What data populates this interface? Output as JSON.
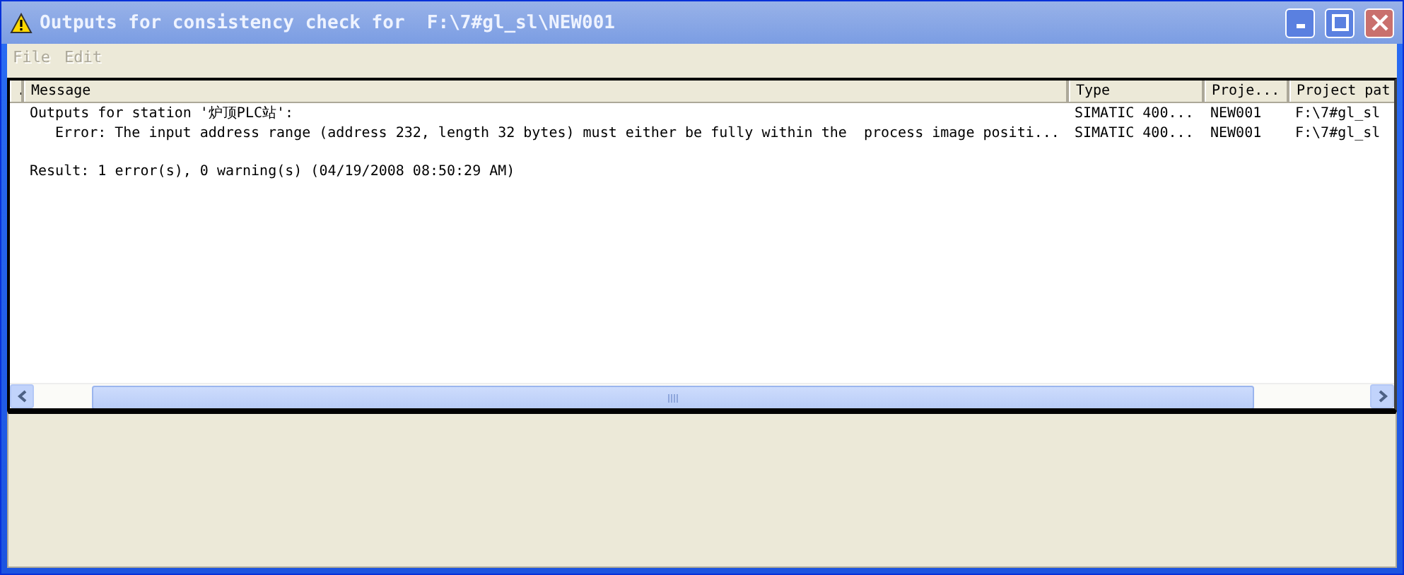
{
  "window": {
    "title": "Outputs for consistency check for  F:\\7#gl_sl\\NEW001"
  },
  "menu": [
    {
      "label": "File",
      "disabled": true
    },
    {
      "label": "Edit",
      "disabled": true
    }
  ],
  "table": {
    "columns": [
      {
        "label": "."
      },
      {
        "label": "Message"
      },
      {
        "label": "Type"
      },
      {
        "label": "Proje..."
      },
      {
        "label": "Project pat"
      }
    ],
    "rows": [
      {
        "kind": "entry",
        "indent": false,
        "cells": [
          "Outputs for station '炉顶PLC站':",
          "SIMATIC 400...",
          "NEW001",
          "F:\\7#gl_sl"
        ]
      },
      {
        "kind": "entry",
        "indent": true,
        "cells": [
          "Error: The input address range (address 232, length 32 bytes) must either be fully within the  process image positi...",
          "SIMATIC 400...",
          "NEW001",
          "F:\\7#gl_sl"
        ]
      },
      {
        "kind": "blank"
      },
      {
        "kind": "entry",
        "indent": false,
        "cells": [
          "Result: 1 error(s), 0 warning(s) (04/19/2008 08:50:29 AM)"
        ]
      }
    ]
  }
}
